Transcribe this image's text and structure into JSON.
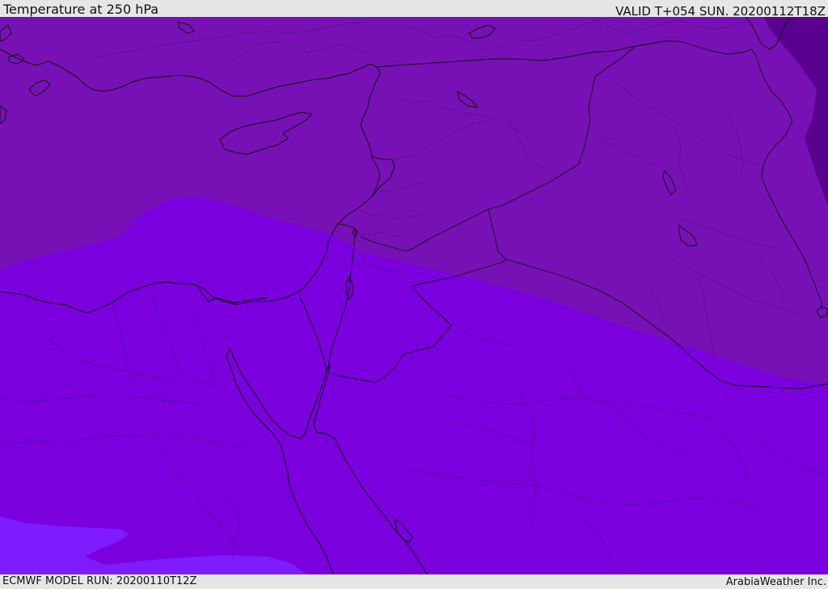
{
  "header": {
    "title": "Temperature at 250 hPa",
    "valid_time": "VALID T+054 SUN. 20200112T18Z"
  },
  "footer": {
    "model_run": "ECMWF MODEL RUN: 20200110T12Z",
    "credit": "ArabiaWeather Inc."
  },
  "map": {
    "variable": "Temperature",
    "pressure_level_hpa": 250,
    "shading_colors": {
      "coldest": "#5a008f",
      "cold_band": "#7711b5",
      "mid_band": "#7a00dd",
      "warm_band": "#7f1bff"
    },
    "line_color": "#111111"
  }
}
